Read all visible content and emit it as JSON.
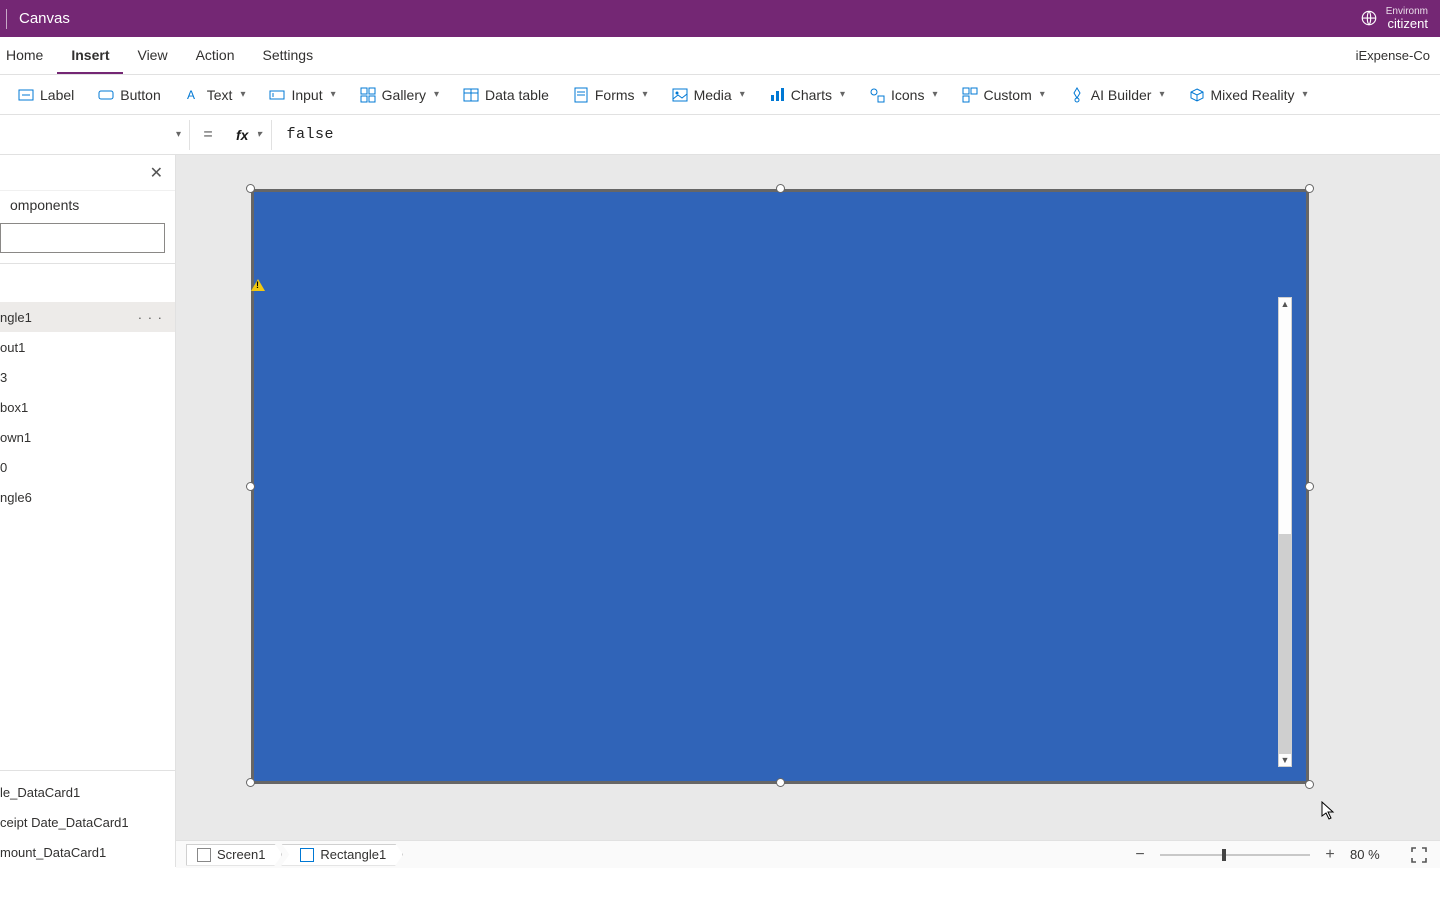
{
  "titlebar": {
    "app_title": "Canvas",
    "env_label": "Environm",
    "env_name": "citizent"
  },
  "menu": {
    "home": "Home",
    "insert": "Insert",
    "view": "View",
    "action": "Action",
    "settings": "Settings",
    "right_context": "iExpense-Co"
  },
  "ribbon": {
    "label": "Label",
    "button": "Button",
    "text": "Text",
    "input": "Input",
    "gallery": "Gallery",
    "datatable": "Data table",
    "forms": "Forms",
    "media": "Media",
    "charts": "Charts",
    "icons": "Icons",
    "custom": "Custom",
    "aibuilder": "AI Builder",
    "mixedreality": "Mixed Reality"
  },
  "formula": {
    "property": "",
    "value": "false"
  },
  "tree": {
    "components_tab": "omponents",
    "items": [
      "ngle1",
      "out1",
      "3",
      "box1",
      "own1",
      "0",
      "ngle6"
    ],
    "selected_index": 0,
    "bottom_items": [
      "le_DataCard1",
      "ceipt Date_DataCard1",
      "mount_DataCard1"
    ]
  },
  "statusbar": {
    "crumb1": "Screen1",
    "crumb2": "Rectangle1",
    "zoom": "80  %"
  },
  "colors": {
    "brand": "#742774",
    "rect_fill": "#3064b8"
  }
}
